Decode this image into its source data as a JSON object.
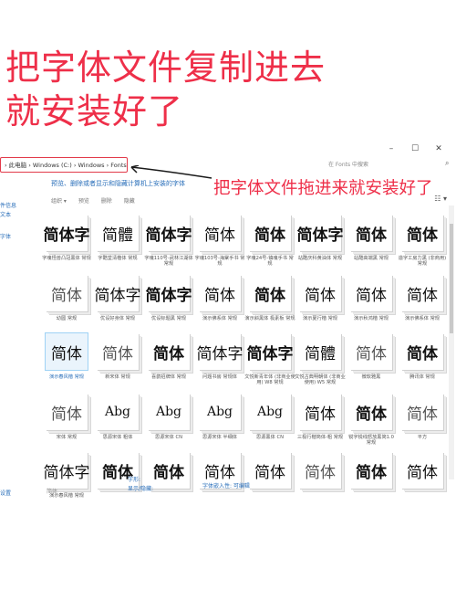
{
  "headline": {
    "line1": "把字体文件复制进去",
    "line2": "就安装好了"
  },
  "window": {
    "controls": {
      "minimize": "–",
      "maximize": "☐",
      "close": "✕"
    },
    "address": "› 此电脑 › Windows (C:) › Windows › Fonts",
    "search_placeholder": "在 Fonts 中搜索",
    "overlay_note": "把字体文件拖进来就安装好了",
    "description": "预览、删除或者显示和隐藏计算机上安装的字体",
    "toolbar": [
      "组织 ▾",
      "预览",
      "删除",
      "隐藏"
    ],
    "nav": [
      "件信息",
      "文本",
      "字体",
      "设置"
    ],
    "status": {
      "left": "字形:",
      "middle": "显示/隐藏:",
      "right": "字体嵌入性: 可编辑"
    }
  },
  "fonts": [
    {
      "glyph": "简体字",
      "label": "字魂怪兽凸冠黑体 常规",
      "style": "bold"
    },
    {
      "glyph": "简體",
      "label": "字酷堂清楷体 常规",
      "style": ""
    },
    {
      "glyph": "简体字",
      "label": "字魂110号-武林江湖体 常规",
      "style": "bold"
    },
    {
      "glyph": "简体",
      "label": "字魂103号-海棠手书 常规",
      "style": ""
    },
    {
      "glyph": "简体",
      "label": "字魂24号-镇魂手书 常规",
      "style": "bold"
    },
    {
      "glyph": "简体字",
      "label": "站酷庆科黄油体 常规",
      "style": "bold"
    },
    {
      "glyph": "简体",
      "label": "站酷高端黑 常规",
      "style": "bold"
    },
    {
      "glyph": "简体",
      "label": "造字工房力黑 (非商用) 常规",
      "style": "bold"
    },
    {
      "glyph": "简体",
      "label": "幼圆 常规",
      "style": "thin"
    },
    {
      "glyph": "简体字",
      "label": "优设好身体 常规",
      "style": ""
    },
    {
      "glyph": "简体字",
      "label": "优设标题黑 常规",
      "style": "bold"
    },
    {
      "glyph": "简体",
      "label": "演示佛系体 常规",
      "style": ""
    },
    {
      "glyph": "简体",
      "label": "演示斜黑体 极素板 常规",
      "style": "bold"
    },
    {
      "glyph": "简体",
      "label": "演示夏行楷 常规",
      "style": ""
    },
    {
      "glyph": "简体",
      "label": "演示秋鸿楷 常规",
      "style": ""
    },
    {
      "glyph": "简体",
      "label": "演示佛系体 常规",
      "style": ""
    },
    {
      "glyph": "简体",
      "label": "演示春风楷 常规",
      "style": "",
      "selected": true
    },
    {
      "glyph": "简体",
      "label": "新宋体 常规",
      "style": "thin"
    },
    {
      "glyph": "简体",
      "label": "喜鹊招牌体 常规",
      "style": "bold"
    },
    {
      "glyph": "简体字",
      "label": "问题书房 常规体",
      "style": ""
    },
    {
      "glyph": "简体字",
      "label": "文悦新青年体 (非商业使用) W8 常规",
      "style": "bold"
    },
    {
      "glyph": "简體",
      "label": "文悦古典明朝体 (非商业使用) W5 常规",
      "style": ""
    },
    {
      "glyph": "简体",
      "label": "微软雅黑",
      "style": "thin"
    },
    {
      "glyph": "简体",
      "label": "腾讯体 常规",
      "style": "bold"
    },
    {
      "glyph": "简体",
      "label": "宋体 常规",
      "style": "thin"
    },
    {
      "glyph": "Abg",
      "label": "思源宋体 粗体",
      "style": "latin"
    },
    {
      "glyph": "Abg",
      "label": "思源宋体 CN",
      "style": "latin"
    },
    {
      "glyph": "Abg",
      "label": "思源宋体 半细体",
      "style": "latin"
    },
    {
      "glyph": "Abg",
      "label": "思源黑体 CN",
      "style": "latin"
    },
    {
      "glyph": "简体",
      "label": "三极行楷简体-粗 常规",
      "style": ""
    },
    {
      "glyph": "简体",
      "label": "锐字锐线怒放黑简1.0 常规",
      "style": "bold"
    },
    {
      "glyph": "简体",
      "label": "平方",
      "style": "thin"
    },
    {
      "glyph": "简体字",
      "label": "演示春风楷 常规",
      "style": ""
    },
    {
      "glyph": "简体",
      "label": "",
      "style": "bold"
    },
    {
      "glyph": "简体",
      "label": "",
      "style": "bold"
    },
    {
      "glyph": "简体",
      "label": "",
      "style": ""
    },
    {
      "glyph": "简体",
      "label": "",
      "style": ""
    },
    {
      "glyph": "简体",
      "label": "",
      "style": "thin"
    },
    {
      "glyph": "简体",
      "label": "",
      "style": "bold"
    },
    {
      "glyph": "简体",
      "label": "",
      "style": ""
    }
  ]
}
